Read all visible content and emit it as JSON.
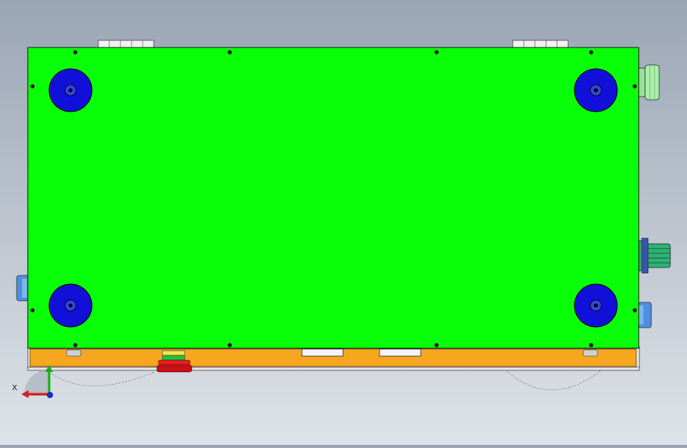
{
  "viewport": {
    "background_top": "#9aa5b4",
    "background_bottom": "#dfe3e8"
  },
  "model": {
    "top_plate_color": "#08ff08",
    "base_color": "#f7a71f",
    "foot_color": "#1010d8",
    "screw_color": "#111111"
  },
  "triad": {
    "x_label": "X",
    "x_axis_color": "#d41c1c",
    "y_axis_color": "#19b01a",
    "z_axis_color": "#1a2bd0"
  }
}
